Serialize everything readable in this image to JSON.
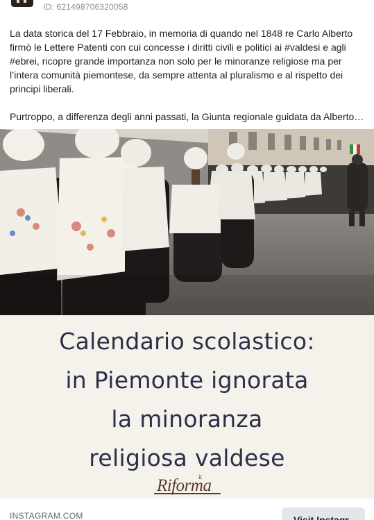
{
  "post": {
    "page_id": "ID: 621498706320058",
    "paragraph_1": "La data storica del 17 Febbraio, in memoria di quando nel 1848 re Carlo Alberto firmò le Lettere Patenti con cui concesse i diritti civili e politici ai #valdesi e agli #ebrei, ricopre grande importanza non solo per le minoranze religiose ma per l’intera comunità piemontese, da sempre attenta al pluralismo e al rispetto dei principi liberali.",
    "paragraph_2": "Purtroppo, a differenza degli anni passati, la Giunta regionale guidata da Alberto…"
  },
  "link_card": {
    "headline_lines": [
      "Calendario scolastico:",
      "in Piemonte ignorata",
      "la minoranza",
      "religiosa valdese"
    ],
    "logo_text": "Riforma",
    "logo_small": "it",
    "source": "INSTAGRAM.COM",
    "button_label": "Visit Instagr..."
  },
  "icons": {
    "avatar": "page-avatar",
    "photo": "procession-photo"
  }
}
